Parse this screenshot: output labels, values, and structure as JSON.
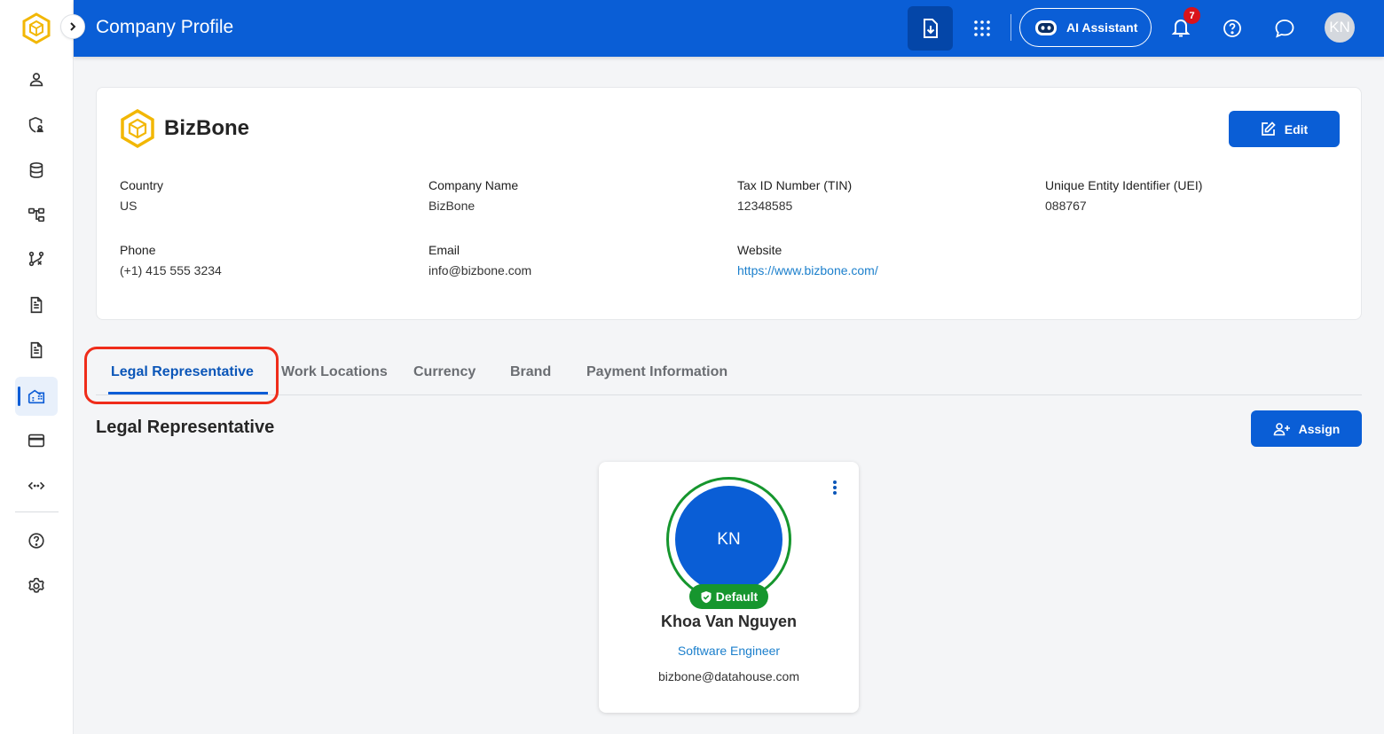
{
  "header": {
    "title": "Company Profile",
    "ai_assistant_label": "AI Assistant",
    "notification_count": "7",
    "user_initials": "KN"
  },
  "sidebar": {
    "items": [
      "user-icon",
      "shield-user-icon",
      "database-icon",
      "hierarchy-icon",
      "workflow-icon",
      "document-icon",
      "document-icon",
      "building-icon",
      "card-icon",
      "code-icon",
      "help-icon",
      "settings-icon"
    ],
    "active_index": 7
  },
  "company": {
    "name": "BizBone",
    "edit_label": "Edit",
    "country_label": "Country",
    "country": "US",
    "company_name_label": "Company Name",
    "company_name": "BizBone",
    "tin_label": "Tax ID Number (TIN)",
    "tin": "12348585",
    "uei_label": "Unique Entity Identifier (UEI)",
    "uei": "088767",
    "phone_label": "Phone",
    "phone": "(+1) 415 555 3234",
    "email_label": "Email",
    "email": "info@bizbone.com",
    "website_label": "Website",
    "website": "https://www.bizbone.com/"
  },
  "tabs": [
    {
      "label": "Legal Representative",
      "active": true
    },
    {
      "label": "Work Locations",
      "active": false
    },
    {
      "label": "Currency",
      "active": false
    },
    {
      "label": "Brand",
      "active": false
    },
    {
      "label": "Payment Information",
      "active": false
    }
  ],
  "section": {
    "title": "Legal Representative",
    "assign_label": "Assign"
  },
  "representative": {
    "initials": "KN",
    "badge": "Default",
    "name": "Khoa Van Nguyen",
    "role": "Software Engineer",
    "email": "bizbone@datahouse.com"
  },
  "colors": {
    "primary": "#0a5ed6",
    "success": "#16962e",
    "highlight": "#ef2c1a",
    "link": "#1b7fcc"
  }
}
